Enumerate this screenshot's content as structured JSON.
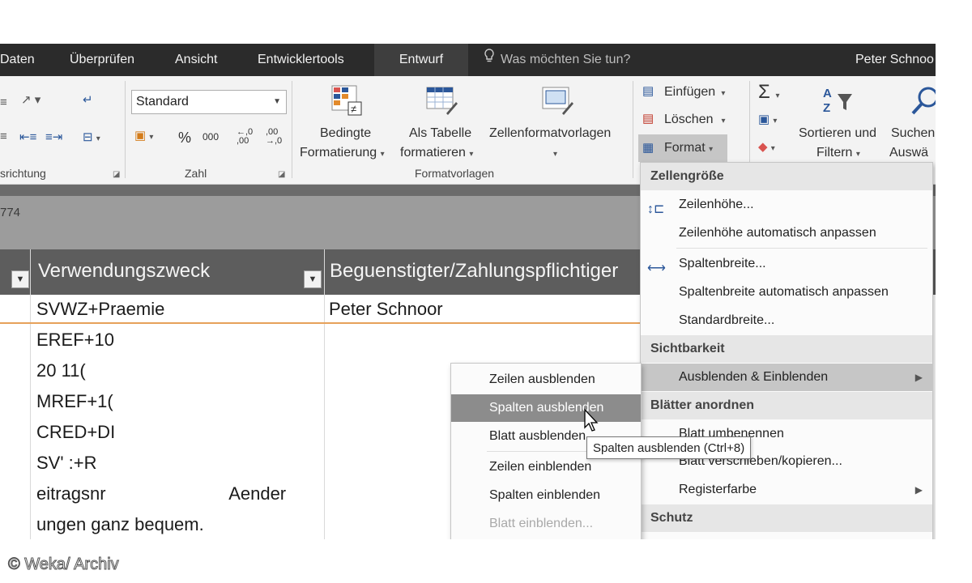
{
  "tabs": [
    {
      "label": "Daten",
      "active": false
    },
    {
      "label": "Überprüfen",
      "active": false
    },
    {
      "label": "Ansicht",
      "active": false
    },
    {
      "label": "Entwicklertools",
      "active": false
    },
    {
      "label": "Entwurf",
      "active": true
    }
  ],
  "tell_me": {
    "placeholder": "Was möchten Sie tun?",
    "icon": "lightbulb-icon"
  },
  "user_name": "Peter Schnoo",
  "ribbon": {
    "alignment_group_label": "srichtung",
    "number_group": {
      "format_value": "Standard",
      "percent": "%",
      "thousands": "000",
      "increase_decimal": "←,0 ,00",
      "decrease_decimal": ",00 →,0",
      "label": "Zahl"
    },
    "styles_group": {
      "conditional_line1": "Bedingte",
      "conditional_line2": "Formatierung",
      "table_line1": "Als Tabelle",
      "table_line2": "formatieren",
      "cellstyles_label": "Zellenformatvorlagen",
      "label": "Formatvorlagen"
    },
    "cells_group": {
      "insert": "Einfügen",
      "delete": "Löschen",
      "format": "Format"
    },
    "editing_group": {
      "sigma": "Σ",
      "sort_line1": "Sortieren und",
      "sort_line2": "Filtern",
      "find_line1": "Suchen",
      "find_line2": "Auswä"
    }
  },
  "formula_bar": {
    "cell_ref": "774"
  },
  "table": {
    "headers": [
      "Verwendungszweck",
      "Beguenstigter/Zahlungspflichtiger"
    ],
    "rows": [
      {
        "purpose": "SVWZ+Praemie",
        "payee": "Peter Schnoor"
      },
      {
        "purpose": "EREF+10",
        "payee": ""
      },
      {
        "purpose": "20     11(",
        "payee": ""
      },
      {
        "purpose": "MREF+1(",
        "payee": ""
      },
      {
        "purpose": "CRED+DI",
        "payee": ""
      },
      {
        "purpose": "SV'    :+R",
        "payee": ""
      },
      {
        "purpose": "eitragsnr                         Aender",
        "payee": ""
      },
      {
        "purpose": "ungen ganz bequem.",
        "payee": ""
      }
    ]
  },
  "format_menu": {
    "sections": {
      "cell_size": "Zellengröße",
      "visibility": "Sichtbarkeit",
      "organize": "Blätter anordnen",
      "protection": "Schutz"
    },
    "items": {
      "row_height": "Zeilenhöhe...",
      "autofit_row": "Zeilenhöhe automatisch anpassen",
      "column_width": "Spaltenbreite...",
      "autofit_column": "Spaltenbreite automatisch anpassen",
      "default_width": "Standardbreite...",
      "hide_unhide": "Ausblenden & Einblenden",
      "rename_sheet": "Blatt umbenennen",
      "move_copy": "Blatt verschieben/kopieren...",
      "tab_color": "Registerfarbe"
    }
  },
  "submenu": {
    "items": [
      {
        "label": "Zeilen ausblenden",
        "highlighted": false,
        "disabled": false
      },
      {
        "label": "Spalten ausblenden",
        "highlighted": true,
        "disabled": false
      },
      {
        "label": "Blatt ausblenden",
        "highlighted": false,
        "disabled": false
      },
      {
        "label": "Zeilen einblenden",
        "highlighted": false,
        "disabled": false
      },
      {
        "label": "Spalten einblenden",
        "highlighted": false,
        "disabled": false
      },
      {
        "label": "Blatt einblenden...",
        "highlighted": false,
        "disabled": true
      }
    ]
  },
  "tooltip": "Spalten ausblenden (Ctrl+8)",
  "copyright": "© Weka/ Archiv",
  "colors": {
    "tabbar": "#2b2b2b",
    "ribbon": "#f3f3f3",
    "header": "#5d5d5d",
    "accent": "#2b579a"
  }
}
